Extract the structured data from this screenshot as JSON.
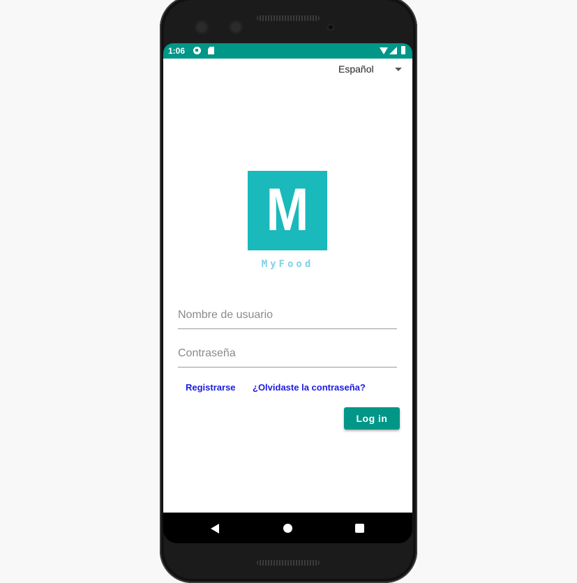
{
  "status_bar": {
    "time": "1:06",
    "icons": [
      "notification-app-icon",
      "sd-card-icon",
      "wifi-icon",
      "signal-icon",
      "battery-icon"
    ],
    "color": "#009688"
  },
  "language_selector": {
    "selected": "Español"
  },
  "logo": {
    "letter": "M",
    "name": "MyFood",
    "color": "#1ab9bb"
  },
  "form": {
    "username_placeholder": "Nombre de usuario",
    "password_placeholder": "Contraseña",
    "register_link": "Registrarse",
    "forgot_link": "¿Olvidaste la contraseña?",
    "login_button": "Log in"
  },
  "nav_bar": {
    "icons": [
      "back-icon",
      "home-icon",
      "recents-icon"
    ]
  }
}
